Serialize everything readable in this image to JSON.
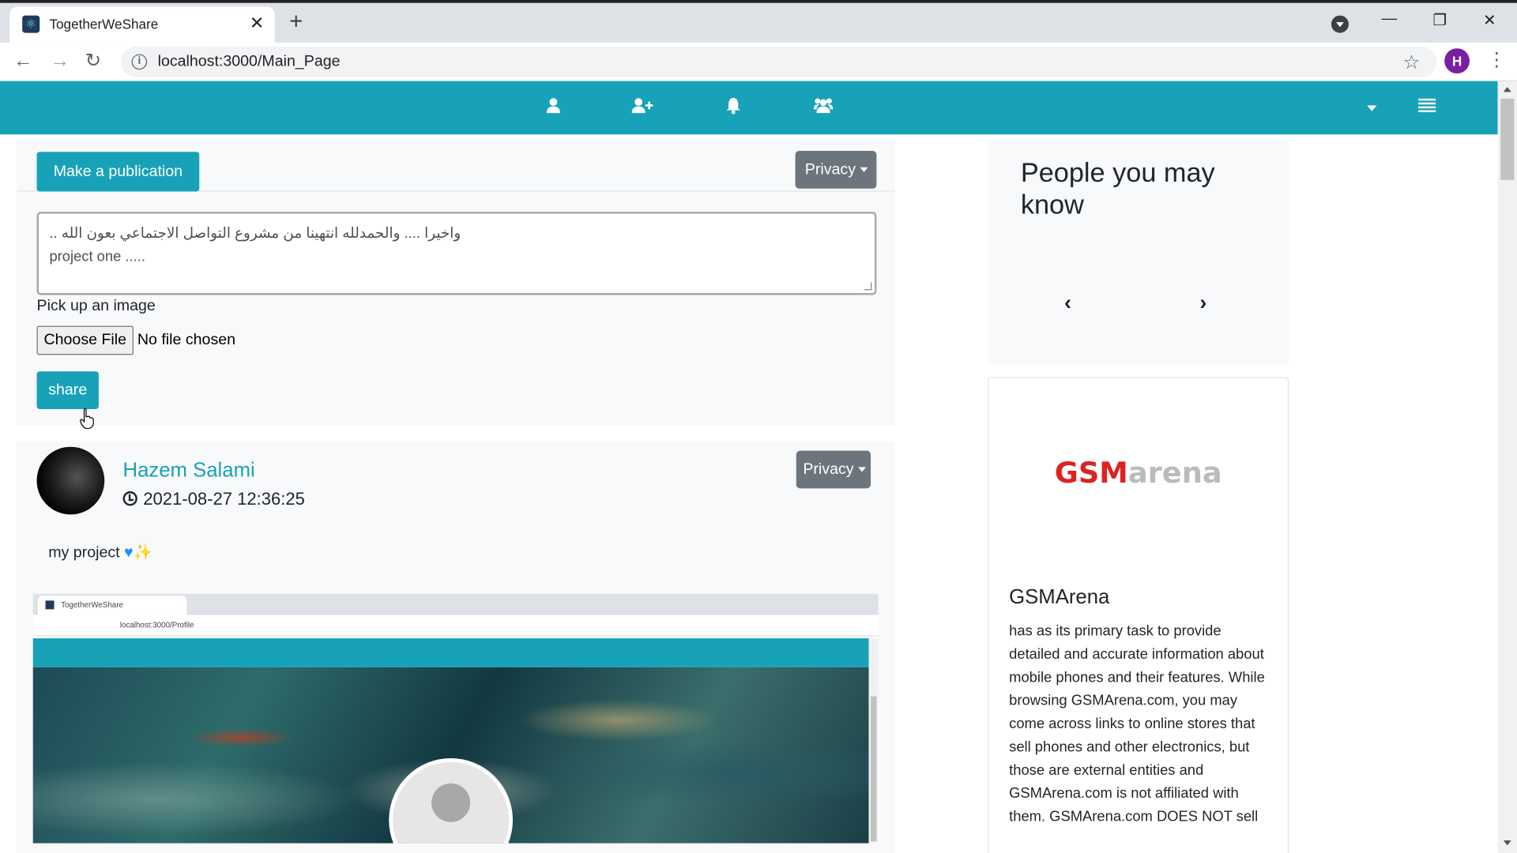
{
  "browser": {
    "tab_title": "TogetherWeShare",
    "url": "localhost:3000/Main_Page",
    "profile_initial": "H"
  },
  "navbar": {
    "icons": [
      "user-icon",
      "user-plus-icon",
      "bell-icon",
      "users-icon"
    ],
    "accent": "#17a2b8"
  },
  "composer": {
    "make_publication_label": "Make a publication",
    "privacy_label": "Privacy",
    "text_line1": "واخيرا .... والحمدلله انتهينا من مشروع التواصل الاجتماعي بعون الله ..",
    "text_line2": "project one .....",
    "pick_image_label": "Pick up an image",
    "choose_file_label": "Choose File",
    "no_file_label": "No file chosen",
    "share_label": "share"
  },
  "post": {
    "author": "Hazem Salami",
    "timestamp": "2021-08-27 12:36:25",
    "privacy_label": "Privacy",
    "text": "my project",
    "embedded": {
      "tab_title": "TogetherWeShare",
      "url": "localhost:3000/Profile"
    }
  },
  "sidebar": {
    "people_title": "People you may know",
    "ad_logo_gsm": "GSM",
    "ad_logo_arena": "arena",
    "ad_title": "GSMArena",
    "ad_text": "has as its primary task to provide detailed and accurate information about mobile phones and their features. While browsing GSMArena.com, you may come across links to online stores that sell phones and other electronics, but those are external entities and GSMArena.com is not affiliated with them. GSMArena.com DOES NOT sell"
  }
}
